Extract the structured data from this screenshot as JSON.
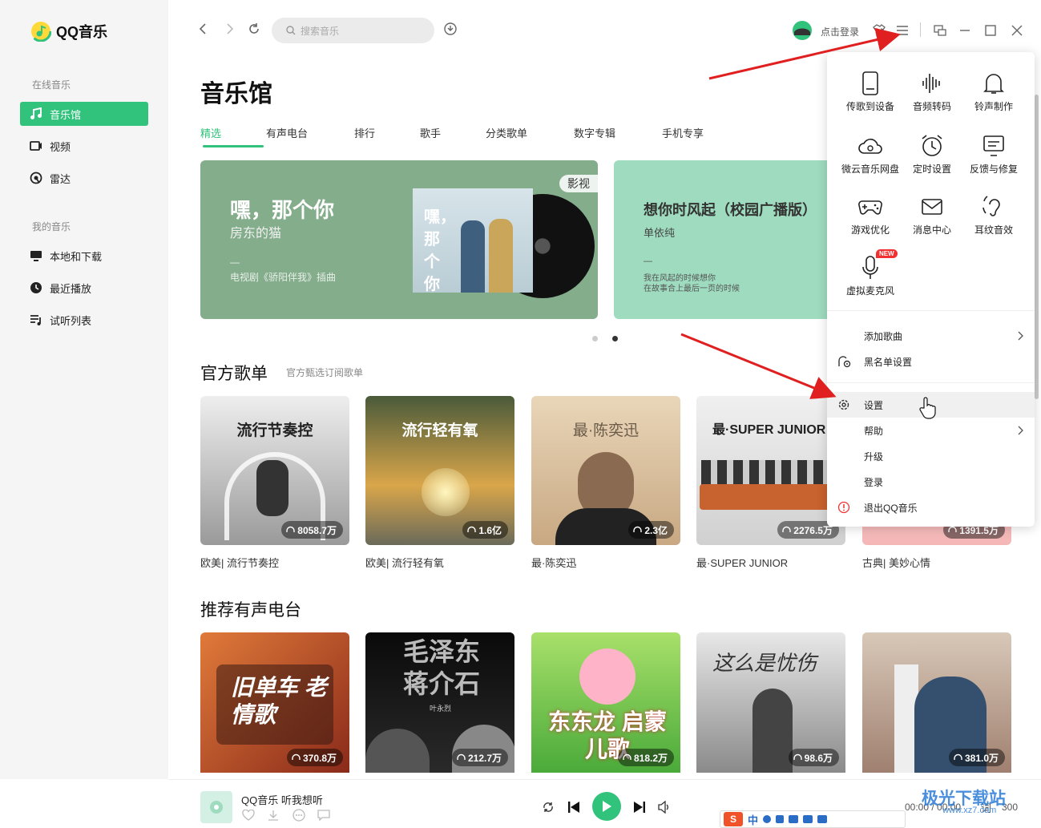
{
  "app": {
    "name": "QQ音乐"
  },
  "sidebar": {
    "online_label": "在线音乐",
    "online_items": [
      {
        "label": "音乐馆",
        "icon": "music-note-icon",
        "active": true
      },
      {
        "label": "视频",
        "icon": "video-icon"
      },
      {
        "label": "雷达",
        "icon": "radar-icon"
      }
    ],
    "mine_label": "我的音乐",
    "mine_items": [
      {
        "label": "本地和下载",
        "icon": "monitor-icon"
      },
      {
        "label": "最近播放",
        "icon": "clock-icon"
      },
      {
        "label": "试听列表",
        "icon": "playlist-icon"
      }
    ]
  },
  "topbar": {
    "search_placeholder": "搜索音乐",
    "login_label": "点击登录"
  },
  "main": {
    "title": "音乐馆",
    "tabs": [
      "精选",
      "有声电台",
      "排行",
      "歌手",
      "分类歌单",
      "数字专辑",
      "手机专享"
    ],
    "active_tab": 0
  },
  "banners": [
    {
      "title": "嘿，那个你",
      "artist": "房东的猫",
      "desc": "电视剧《骄阳伴我》插曲",
      "tag": "影视",
      "cover_text": "嘿，那个你"
    },
    {
      "title": "想你时风起（校园广播版）",
      "artist": "单依纯",
      "desc_line1": "我在风起的时候想你",
      "desc_line2": "在故事合上最后一页的时候"
    }
  ],
  "official_playlists": {
    "title": "官方歌单",
    "subtitle": "官方甄选订阅歌单",
    "items": [
      {
        "cover_text": "流行节奏控",
        "plays": "8058.7万",
        "caption": "欧美| 流行节奏控"
      },
      {
        "cover_text": "流行轻有氧",
        "plays": "1.6亿",
        "caption": "欧美| 流行轻有氧"
      },
      {
        "cover_text": "最·陈奕迅",
        "plays": "2.3亿",
        "caption": "最·陈奕迅"
      },
      {
        "cover_text": "最·SUPER JUNIOR",
        "plays": "2276.5万",
        "caption": "最·SUPER JUNIOR"
      },
      {
        "cover_text": "",
        "plays": "1391.5万",
        "caption": "古典| 美妙心情"
      }
    ]
  },
  "radio": {
    "title": "推荐有声电台",
    "items": [
      {
        "cover_text": "旧单车 老情歌",
        "plays": "370.8万"
      },
      {
        "cover_text": "毛泽东 蒋介石",
        "cover_sub": "叶永烈",
        "plays": "212.7万"
      },
      {
        "cover_text": "东东龙 启蒙儿歌",
        "plays": "818.2万"
      },
      {
        "cover_text": "这么是忧伤",
        "plays": "98.6万"
      },
      {
        "cover_text": "",
        "plays": "381.0万"
      }
    ]
  },
  "player": {
    "song_label": "QQ音乐 听我想听",
    "time": "00:00 / 00:00",
    "lyric_label": "词",
    "count": "300"
  },
  "menu": {
    "grid": [
      {
        "label": "传歌到设备",
        "icon": "phone-icon"
      },
      {
        "label": "音频转码",
        "icon": "audio-wave-icon"
      },
      {
        "label": "铃声制作",
        "icon": "bell-icon"
      },
      {
        "label": "微云音乐网盘",
        "icon": "cloud-icon"
      },
      {
        "label": "定时设置",
        "icon": "alarm-clock-icon"
      },
      {
        "label": "反馈与修复",
        "icon": "feedback-icon"
      },
      {
        "label": "游戏优化",
        "icon": "gamepad-icon"
      },
      {
        "label": "消息中心",
        "icon": "envelope-icon"
      },
      {
        "label": "耳纹音效",
        "icon": "ear-icon"
      },
      {
        "label": "虚拟麦克风",
        "icon": "microphone-icon",
        "badge": "NEW"
      }
    ],
    "rows": [
      {
        "label": "添加歌曲",
        "chevron": true
      },
      {
        "label": "黑名单设置",
        "icon": "blacklist-gear-icon"
      },
      {
        "label": "设置",
        "icon": "gear-icon",
        "highlighted": true
      },
      {
        "label": "帮助",
        "chevron": true
      },
      {
        "label": "升级"
      },
      {
        "label": "登录"
      },
      {
        "label": "退出QQ音乐",
        "icon": "exit-icon"
      }
    ]
  },
  "watermark": {
    "text": "极光下载站",
    "url": "www.xz7.com"
  },
  "ime": {
    "text": "中"
  },
  "colors": {
    "accent": "#31c27c",
    "annotation_arrow": "#e02020"
  }
}
